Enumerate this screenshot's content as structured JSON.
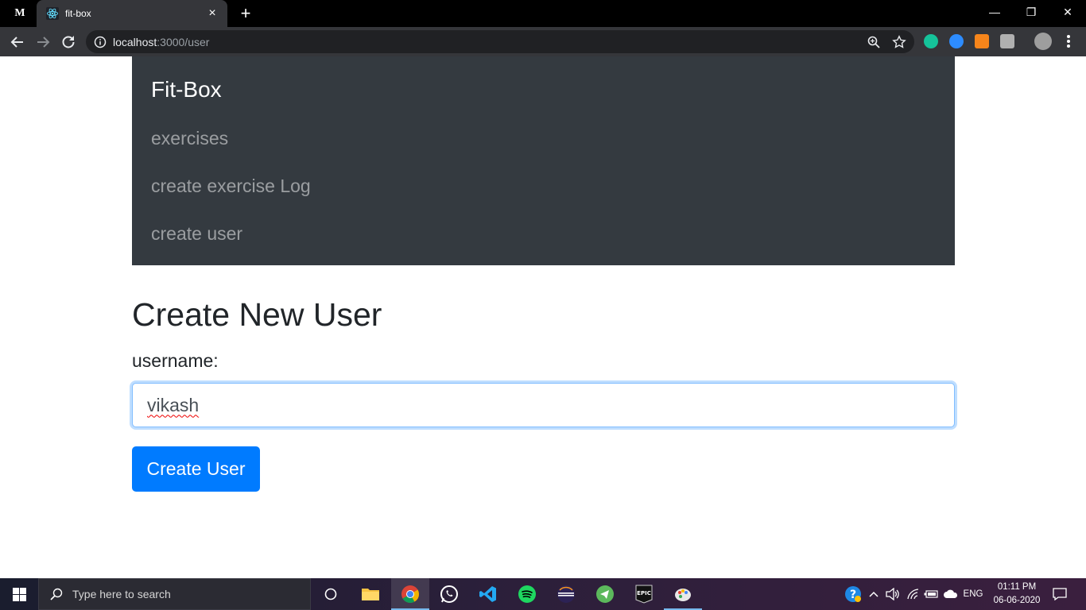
{
  "browser": {
    "pinned_tab_letter": "M",
    "tab_title": "fit-box",
    "tab_close": "×",
    "new_tab": "+",
    "window_controls": {
      "minimize": "—",
      "restore": "❐",
      "close": "✕"
    },
    "url_host": "localhost",
    "url_rest": ":3000/user"
  },
  "navbar": {
    "brand": "Fit-Box",
    "links": [
      "exercises",
      "create exercise Log",
      "create user"
    ],
    "bg_color": "#343a40"
  },
  "form": {
    "heading": "Create New User",
    "label": "username:",
    "input_value": "vikash",
    "submit_label": "Create User",
    "accent_color": "#007bff"
  },
  "taskbar": {
    "search_placeholder": "Type here to search",
    "language": "ENG",
    "time": "01:11 PM",
    "date": "06-06-2020"
  }
}
